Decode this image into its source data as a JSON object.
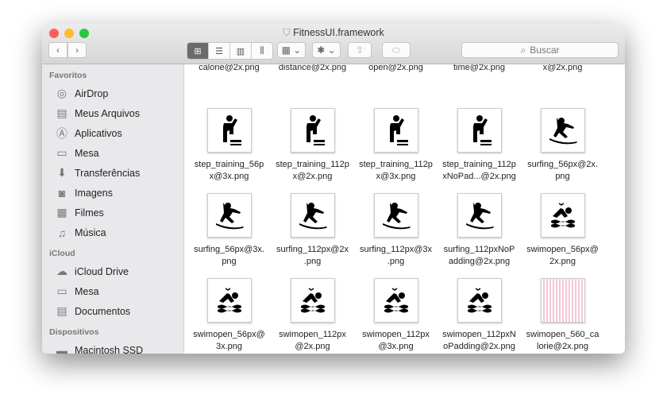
{
  "window": {
    "title": "FitnessUI.framework"
  },
  "toolbar": {
    "search_placeholder": "Buscar",
    "views": [
      "icon-view",
      "list-view",
      "column-view",
      "cover-flow-view"
    ],
    "active_view": 0
  },
  "sidebar": {
    "sections": [
      {
        "title": "Favoritos",
        "items": [
          {
            "label": "AirDrop",
            "icon": "airdrop-icon",
            "g": "◎"
          },
          {
            "label": "Meus Arquivos",
            "icon": "all-files-icon",
            "g": "▤"
          },
          {
            "label": "Aplicativos",
            "icon": "applications-icon",
            "g": "Ⓐ"
          },
          {
            "label": "Mesa",
            "icon": "desktop-icon",
            "g": "▭"
          },
          {
            "label": "Transferências",
            "icon": "downloads-icon",
            "g": "⬇"
          },
          {
            "label": "Imagens",
            "icon": "pictures-icon",
            "g": "◙"
          },
          {
            "label": "Filmes",
            "icon": "movies-icon",
            "g": "▦"
          },
          {
            "label": "Música",
            "icon": "music-icon",
            "g": "♫"
          }
        ]
      },
      {
        "title": "iCloud",
        "items": [
          {
            "label": "iCloud Drive",
            "icon": "cloud-icon",
            "g": "☁"
          },
          {
            "label": "Mesa",
            "icon": "desktop-icon",
            "g": "▭"
          },
          {
            "label": "Documentos",
            "icon": "documents-icon",
            "g": "▤"
          }
        ]
      },
      {
        "title": "Dispositivos",
        "items": [
          {
            "label": "Macintosh SSD",
            "icon": "disk-icon",
            "g": "▬"
          }
        ]
      }
    ]
  },
  "files": [
    [
      "calorie@2x.png",
      "distance@2x.png",
      "open@2x.png",
      "time@2x.png",
      "x@2x.png"
    ],
    [
      [
        "step_training_56p",
        "x@3x.png",
        "step"
      ],
      [
        "step_training_112p",
        "x@2x.png",
        "step"
      ],
      [
        "step_training_112p",
        "x@3x.png",
        "step"
      ],
      [
        "step_training_112p",
        "xNoPad...@2x.png",
        "step"
      ],
      [
        "surfing_56px@2x.",
        "png",
        "surf"
      ]
    ],
    [
      [
        "surfing_56px@3x.",
        "png",
        "surf"
      ],
      [
        "surfing_112px@2x",
        ".png",
        "surf"
      ],
      [
        "surfing_112px@3x",
        ".png",
        "surf"
      ],
      [
        "surfing_112pxNoP",
        "adding@2x.png",
        "surf"
      ],
      [
        "swimopen_56px@",
        "2x.png",
        "swim"
      ]
    ],
    [
      [
        "swimopen_56px@",
        "3x.png",
        "swim"
      ],
      [
        "swimopen_112px",
        "@2x.png",
        "swim"
      ],
      [
        "swimopen_112px",
        "@3x.png",
        "swim"
      ],
      [
        "swimopen_112pxN",
        "oPadding@2x.png",
        "swim"
      ],
      [
        "swimopen_560_ca",
        "lorie@2x.png",
        "#f5c6d8"
      ]
    ],
    [
      "#cfeaf5",
      "#eef5cc",
      "#f7f2c8",
      "#f5c6d8",
      "#cfeaf5"
    ]
  ]
}
